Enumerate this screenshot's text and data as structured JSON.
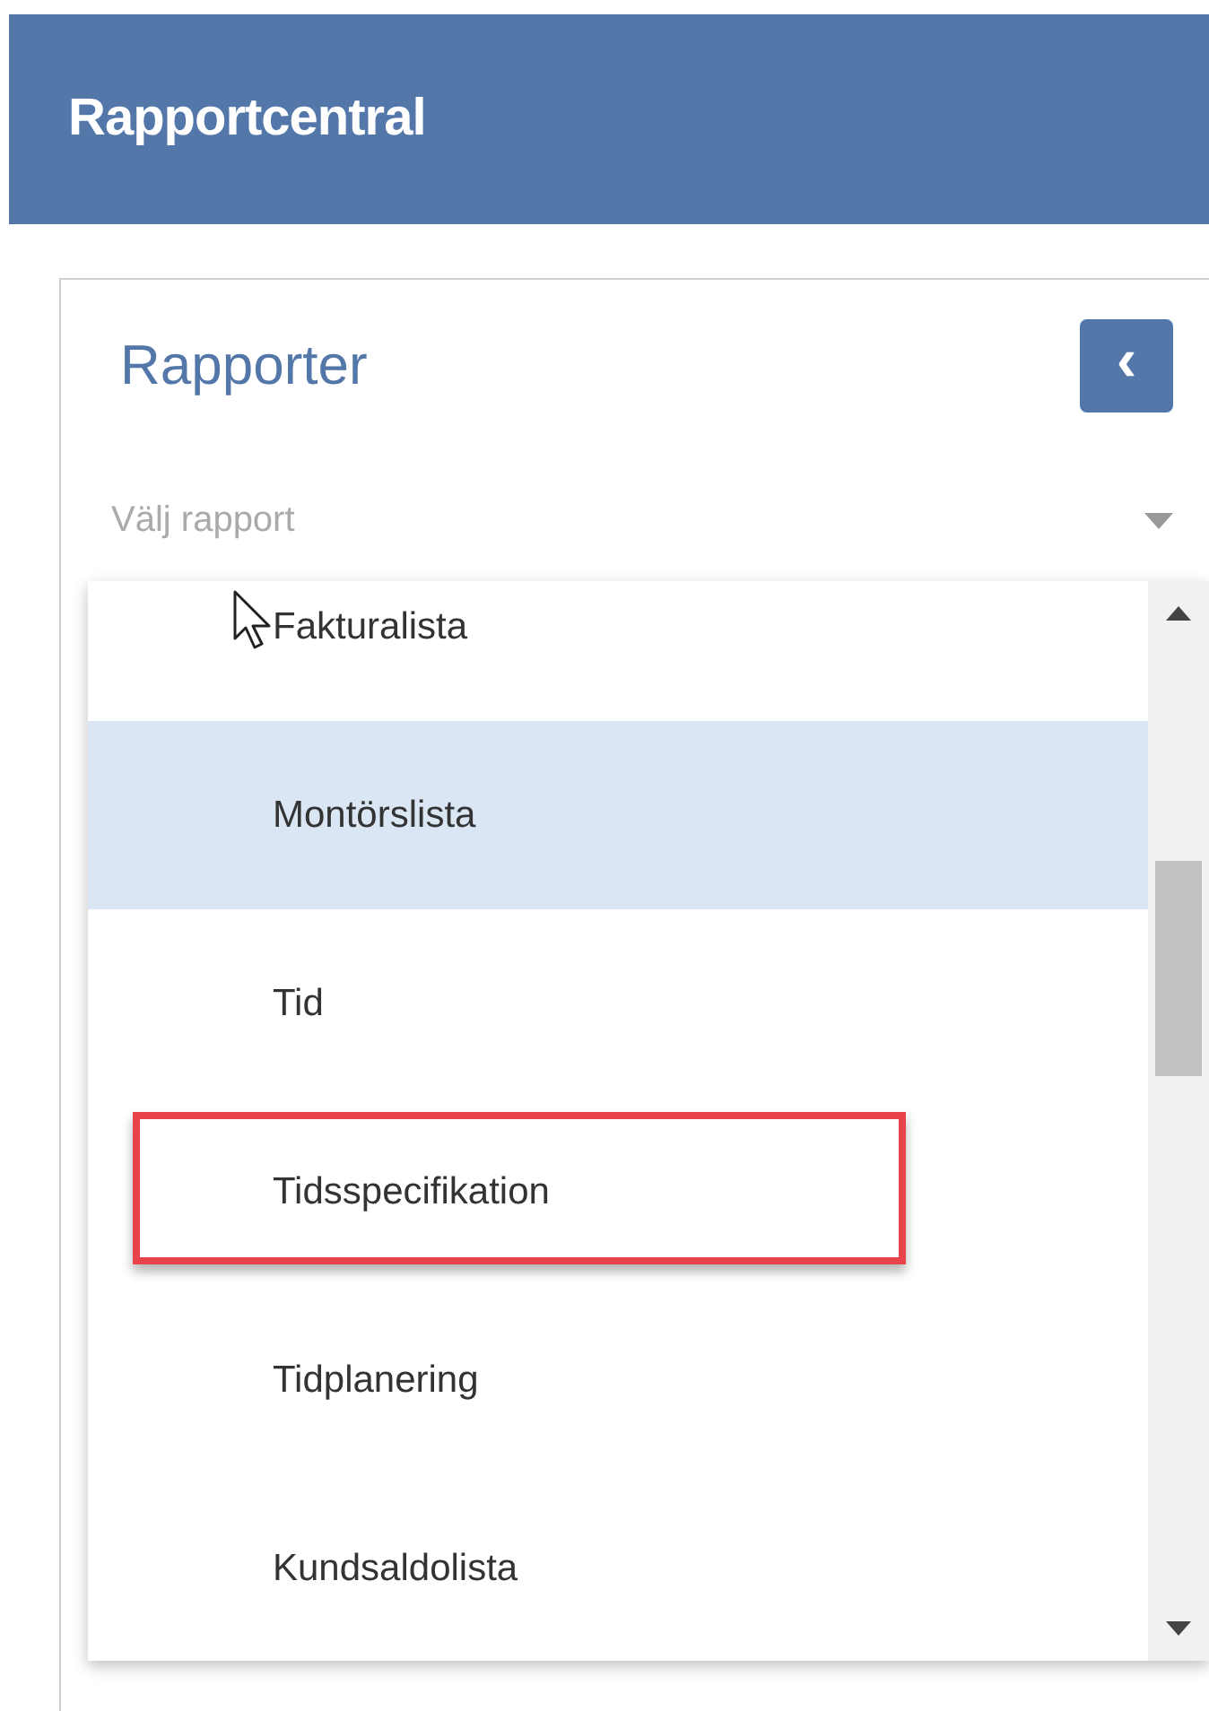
{
  "header": {
    "title": "Rapportcentral"
  },
  "panel": {
    "title": "Rapporter",
    "collapse_button": "‹",
    "select": {
      "placeholder": "Välj rapport"
    }
  },
  "reports": [
    {
      "label": "Fakturalista",
      "selected": false,
      "highlighted": false
    },
    {
      "label": "Montörslista",
      "selected": true,
      "highlighted": false
    },
    {
      "label": "Tid",
      "selected": false,
      "highlighted": false
    },
    {
      "label": "Tidsspecifikation",
      "selected": false,
      "highlighted": true
    },
    {
      "label": "Tidplanering",
      "selected": false,
      "highlighted": false
    },
    {
      "label": "Kundsaldolista",
      "selected": false,
      "highlighted": false
    }
  ]
}
